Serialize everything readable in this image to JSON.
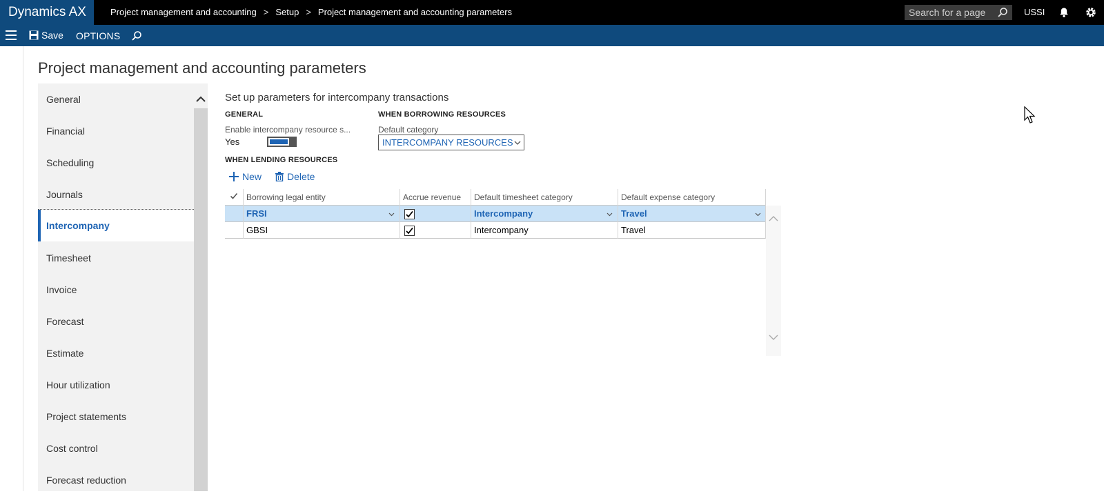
{
  "app": {
    "brand": "Dynamics AX",
    "company": "USSI"
  },
  "breadcrumb": [
    "Project management and accounting",
    "Setup",
    "Project management and accounting parameters"
  ],
  "search": {
    "placeholder": "Search for a page"
  },
  "actionbar": {
    "save_label": "Save",
    "options_label": "OPTIONS"
  },
  "page": {
    "title": "Project management and accounting parameters"
  },
  "nav": {
    "items": [
      {
        "label": "General"
      },
      {
        "label": "Financial"
      },
      {
        "label": "Scheduling"
      },
      {
        "label": "Journals"
      },
      {
        "label": "Intercompany",
        "active": true
      },
      {
        "label": "Timesheet"
      },
      {
        "label": "Invoice"
      },
      {
        "label": "Forecast"
      },
      {
        "label": "Estimate"
      },
      {
        "label": "Hour utilization"
      },
      {
        "label": "Project statements"
      },
      {
        "label": "Cost control"
      },
      {
        "label": "Forecast reduction"
      }
    ]
  },
  "content": {
    "subtitle": "Set up parameters for intercompany transactions",
    "general": {
      "heading": "GENERAL",
      "enable_label": "Enable intercompany resource s...",
      "enable_value": "Yes"
    },
    "borrowing": {
      "heading": "WHEN BORROWING RESOURCES",
      "category_label": "Default category",
      "category_value": "INTERCOMPANY RESOURCES"
    },
    "lending": {
      "heading": "WHEN LENDING RESOURCES",
      "new_label": "New",
      "delete_label": "Delete"
    }
  },
  "grid": {
    "columns": [
      "Borrowing legal entity",
      "Accrue revenue",
      "Default timesheet category",
      "Default expense category"
    ],
    "rows": [
      {
        "entity": "FRSI",
        "accrue": true,
        "timesheet": "Intercompany",
        "expense": "Travel",
        "selected": true
      },
      {
        "entity": "GBSI",
        "accrue": true,
        "timesheet": "Intercompany",
        "expense": "Travel",
        "selected": false
      }
    ]
  },
  "colors": {
    "brand_blue": "#0f4a7d",
    "accent": "#1e64b4",
    "selected_row": "#c9e2f7"
  }
}
